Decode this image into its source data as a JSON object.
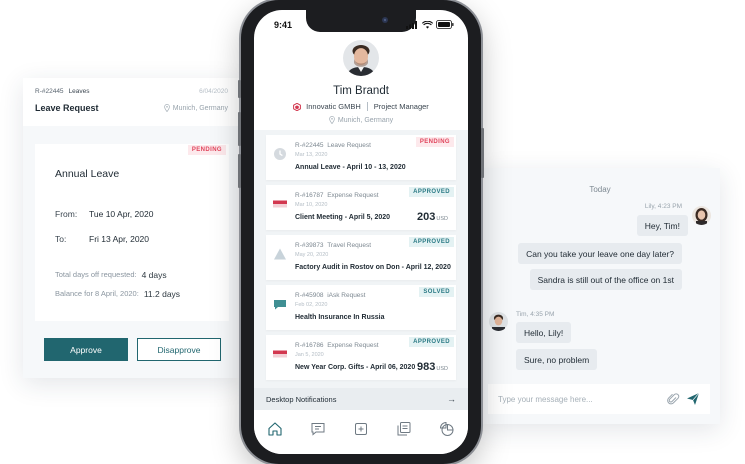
{
  "left_card": {
    "ref": "R-#22445",
    "kind": "Leaves",
    "date": "6/04/2020",
    "title": "Leave Request",
    "location": "Munich, Germany",
    "status": "PENDING",
    "leave_type": "Annual Leave",
    "from_label": "From:",
    "from_value": "Tue 10 Apr, 2020",
    "to_label": "To:",
    "to_value": "Fri 13 Apr, 2020",
    "total_label": "Total days off requested:",
    "total_value": "4 days",
    "balance_label": "Balance for 8 April, 2020:",
    "balance_value": "11.2 days",
    "approve_label": "Approve",
    "disapprove_label": "Disapprove",
    "accent_color": "#21666f"
  },
  "phone": {
    "status_time": "9:41",
    "profile": {
      "name": "Tim Brandt",
      "company": "Innovatic GMBH",
      "role": "Project Manager",
      "location": "Munich, Germany"
    },
    "requests": [
      {
        "icon": "clock-icon",
        "ref": "R-#22445",
        "kind": "Leave Request",
        "date": "Mar 13, 2020",
        "title": "Annual Leave - April 10 - 13, 2020",
        "status": "PENDING",
        "amount": "",
        "currency": ""
      },
      {
        "icon": "flag-icon",
        "ref": "R-#16787",
        "kind": "Expense Request",
        "date": "Mar 10, 2020",
        "title": "Client Meeting - April 5, 2020",
        "status": "APPROVED",
        "amount": "203",
        "currency": "USD"
      },
      {
        "icon": "triangle-icon",
        "ref": "R-#39873",
        "kind": "Travel Request",
        "date": "May 20, 2020",
        "title": "Factory Audit in Rostov on Don - April 12, 2020",
        "status": "APPROVED",
        "amount": "",
        "currency": ""
      },
      {
        "icon": "chat-icon",
        "ref": "R-#45908",
        "kind": "iAsk Request",
        "date": "Feb 02, 2020",
        "title": "Health Insurance In Russia",
        "status": "SOLVED",
        "amount": "",
        "currency": ""
      },
      {
        "icon": "flag-icon",
        "ref": "R-#16786",
        "kind": "Expense Request",
        "date": "Jan 5, 2020",
        "title": "New Year Corp. Gifts - April 06, 2020",
        "status": "APPROVED",
        "amount": "983",
        "currency": "USD"
      }
    ],
    "desktop_notifications": "Desktop Notifications",
    "tabs": [
      "home-icon",
      "message-icon",
      "add-icon",
      "documents-icon",
      "reports-icon"
    ]
  },
  "chat": {
    "day": "Today",
    "lily_meta": "Lily, 4:23 PM",
    "lily_messages": [
      "Hey, Tim!",
      "Can you take your leave one day later?",
      "Sandra is still out of the office on 1st"
    ],
    "tim_meta": "Tim, 4:35 PM",
    "tim_messages": [
      "Hello, Lily!",
      "Sure, no problem"
    ],
    "input_placeholder": "Type your message here..."
  }
}
